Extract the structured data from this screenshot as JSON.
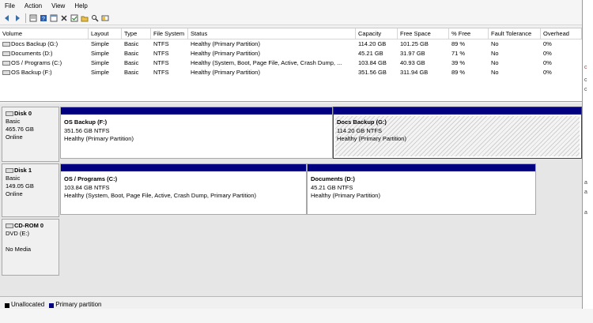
{
  "menu": [
    "File",
    "Action",
    "View",
    "Help"
  ],
  "toolbar_icons": [
    "back-icon",
    "forward-icon",
    "properties-icon",
    "help-icon",
    "console-icon",
    "delete-icon",
    "check-icon",
    "open-icon",
    "search-icon",
    "explore-icon"
  ],
  "volumes": {
    "headers": [
      "Volume",
      "Layout",
      "Type",
      "File System",
      "Status",
      "Capacity",
      "Free Space",
      "% Free",
      "Fault Tolerance",
      "Overhead"
    ],
    "rows": [
      [
        "Docs Backup (G:)",
        "Simple",
        "Basic",
        "NTFS",
        "Healthy (Primary Partition)",
        "114.20 GB",
        "101.25 GB",
        "89 %",
        "No",
        "0%"
      ],
      [
        "Documents (D:)",
        "Simple",
        "Basic",
        "NTFS",
        "Healthy (Primary Partition)",
        "45.21 GB",
        "31.97 GB",
        "71 %",
        "No",
        "0%"
      ],
      [
        "OS / Programs (C:)",
        "Simple",
        "Basic",
        "NTFS",
        "Healthy (System, Boot, Page File, Active, Crash Dump, ...",
        "103.84 GB",
        "40.93 GB",
        "39 %",
        "No",
        "0%"
      ],
      [
        "OS Backup (F:)",
        "Simple",
        "Basic",
        "NTFS",
        "Healthy (Primary Partition)",
        "351.56 GB",
        "311.94 GB",
        "89 %",
        "No",
        "0%"
      ]
    ]
  },
  "disks": [
    {
      "name": "Disk 0",
      "type": "Basic",
      "size": "465.76 GB",
      "state": "Online",
      "partitions": [
        {
          "title": "OS Backup  (F:)",
          "size": "351.56 GB NTFS",
          "status": "Healthy (Primary Partition)"
        },
        {
          "title": "Docs Backup  (G:)",
          "size": "114.20 GB NTFS",
          "status": "Healthy (Primary Partition)"
        }
      ]
    },
    {
      "name": "Disk 1",
      "type": "Basic",
      "size": "149.05 GB",
      "state": "Online",
      "partitions": [
        {
          "title": "OS / Programs  (C:)",
          "size": "103.84 GB NTFS",
          "status": "Healthy (System, Boot, Page File, Active, Crash Dump, Primary Partition)"
        },
        {
          "title": "Documents  (D:)",
          "size": "45.21 GB NTFS",
          "status": "Healthy (Primary Partition)"
        }
      ]
    },
    {
      "name": "CD-ROM 0",
      "type": "DVD (E:)",
      "size": "",
      "state": "No Media",
      "partitions": []
    }
  ],
  "legend": [
    {
      "label": "Unallocated",
      "color": "#000000"
    },
    {
      "label": "Primary partition",
      "color": "#000080"
    }
  ],
  "right_strip_text": [
    "c",
    "c",
    "c",
    "a",
    "a",
    "a"
  ]
}
